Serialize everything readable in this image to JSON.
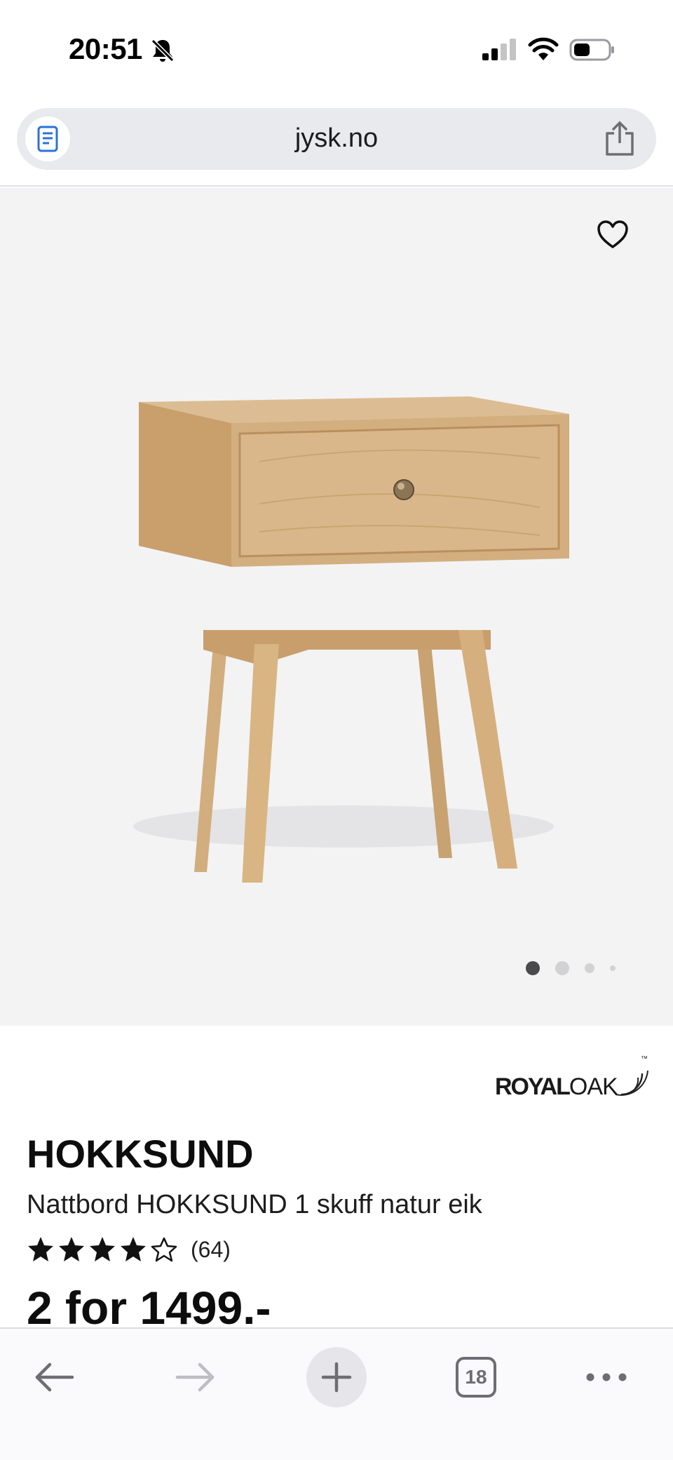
{
  "status_bar": {
    "time": "20:51",
    "icons": [
      "bell-slash-icon",
      "cellular-signal-icon",
      "wifi-icon",
      "battery-icon"
    ]
  },
  "browser": {
    "url": "jysk.no",
    "reader_icon": "reader-mode-icon",
    "share_icon": "share-icon"
  },
  "product": {
    "image_indicator": {
      "count": 4,
      "active_index": 0
    },
    "favorite_icon": "heart-icon",
    "brand": {
      "bold_part": "ROYAL",
      "light_part": "OAK",
      "tm": "™"
    },
    "name": "HOKKSUND",
    "description": "Nattbord HOKKSUND 1 skuff natur eik",
    "rating": {
      "stars_filled": 4,
      "stars_total": 5,
      "review_count": "(64)"
    },
    "price": "2 for 1499.-"
  },
  "toolbar": {
    "back_icon": "back-arrow-icon",
    "forward_icon": "forward-arrow-icon",
    "new_tab_icon": "plus-icon",
    "tabs_count": "18",
    "more_icon": "more-icon"
  },
  "colors": {
    "accent_blue": "#2c72d9",
    "wood": "#d7b384",
    "hero_bg": "#f3f3f4",
    "toolbar_icon": "#6d6d72"
  }
}
